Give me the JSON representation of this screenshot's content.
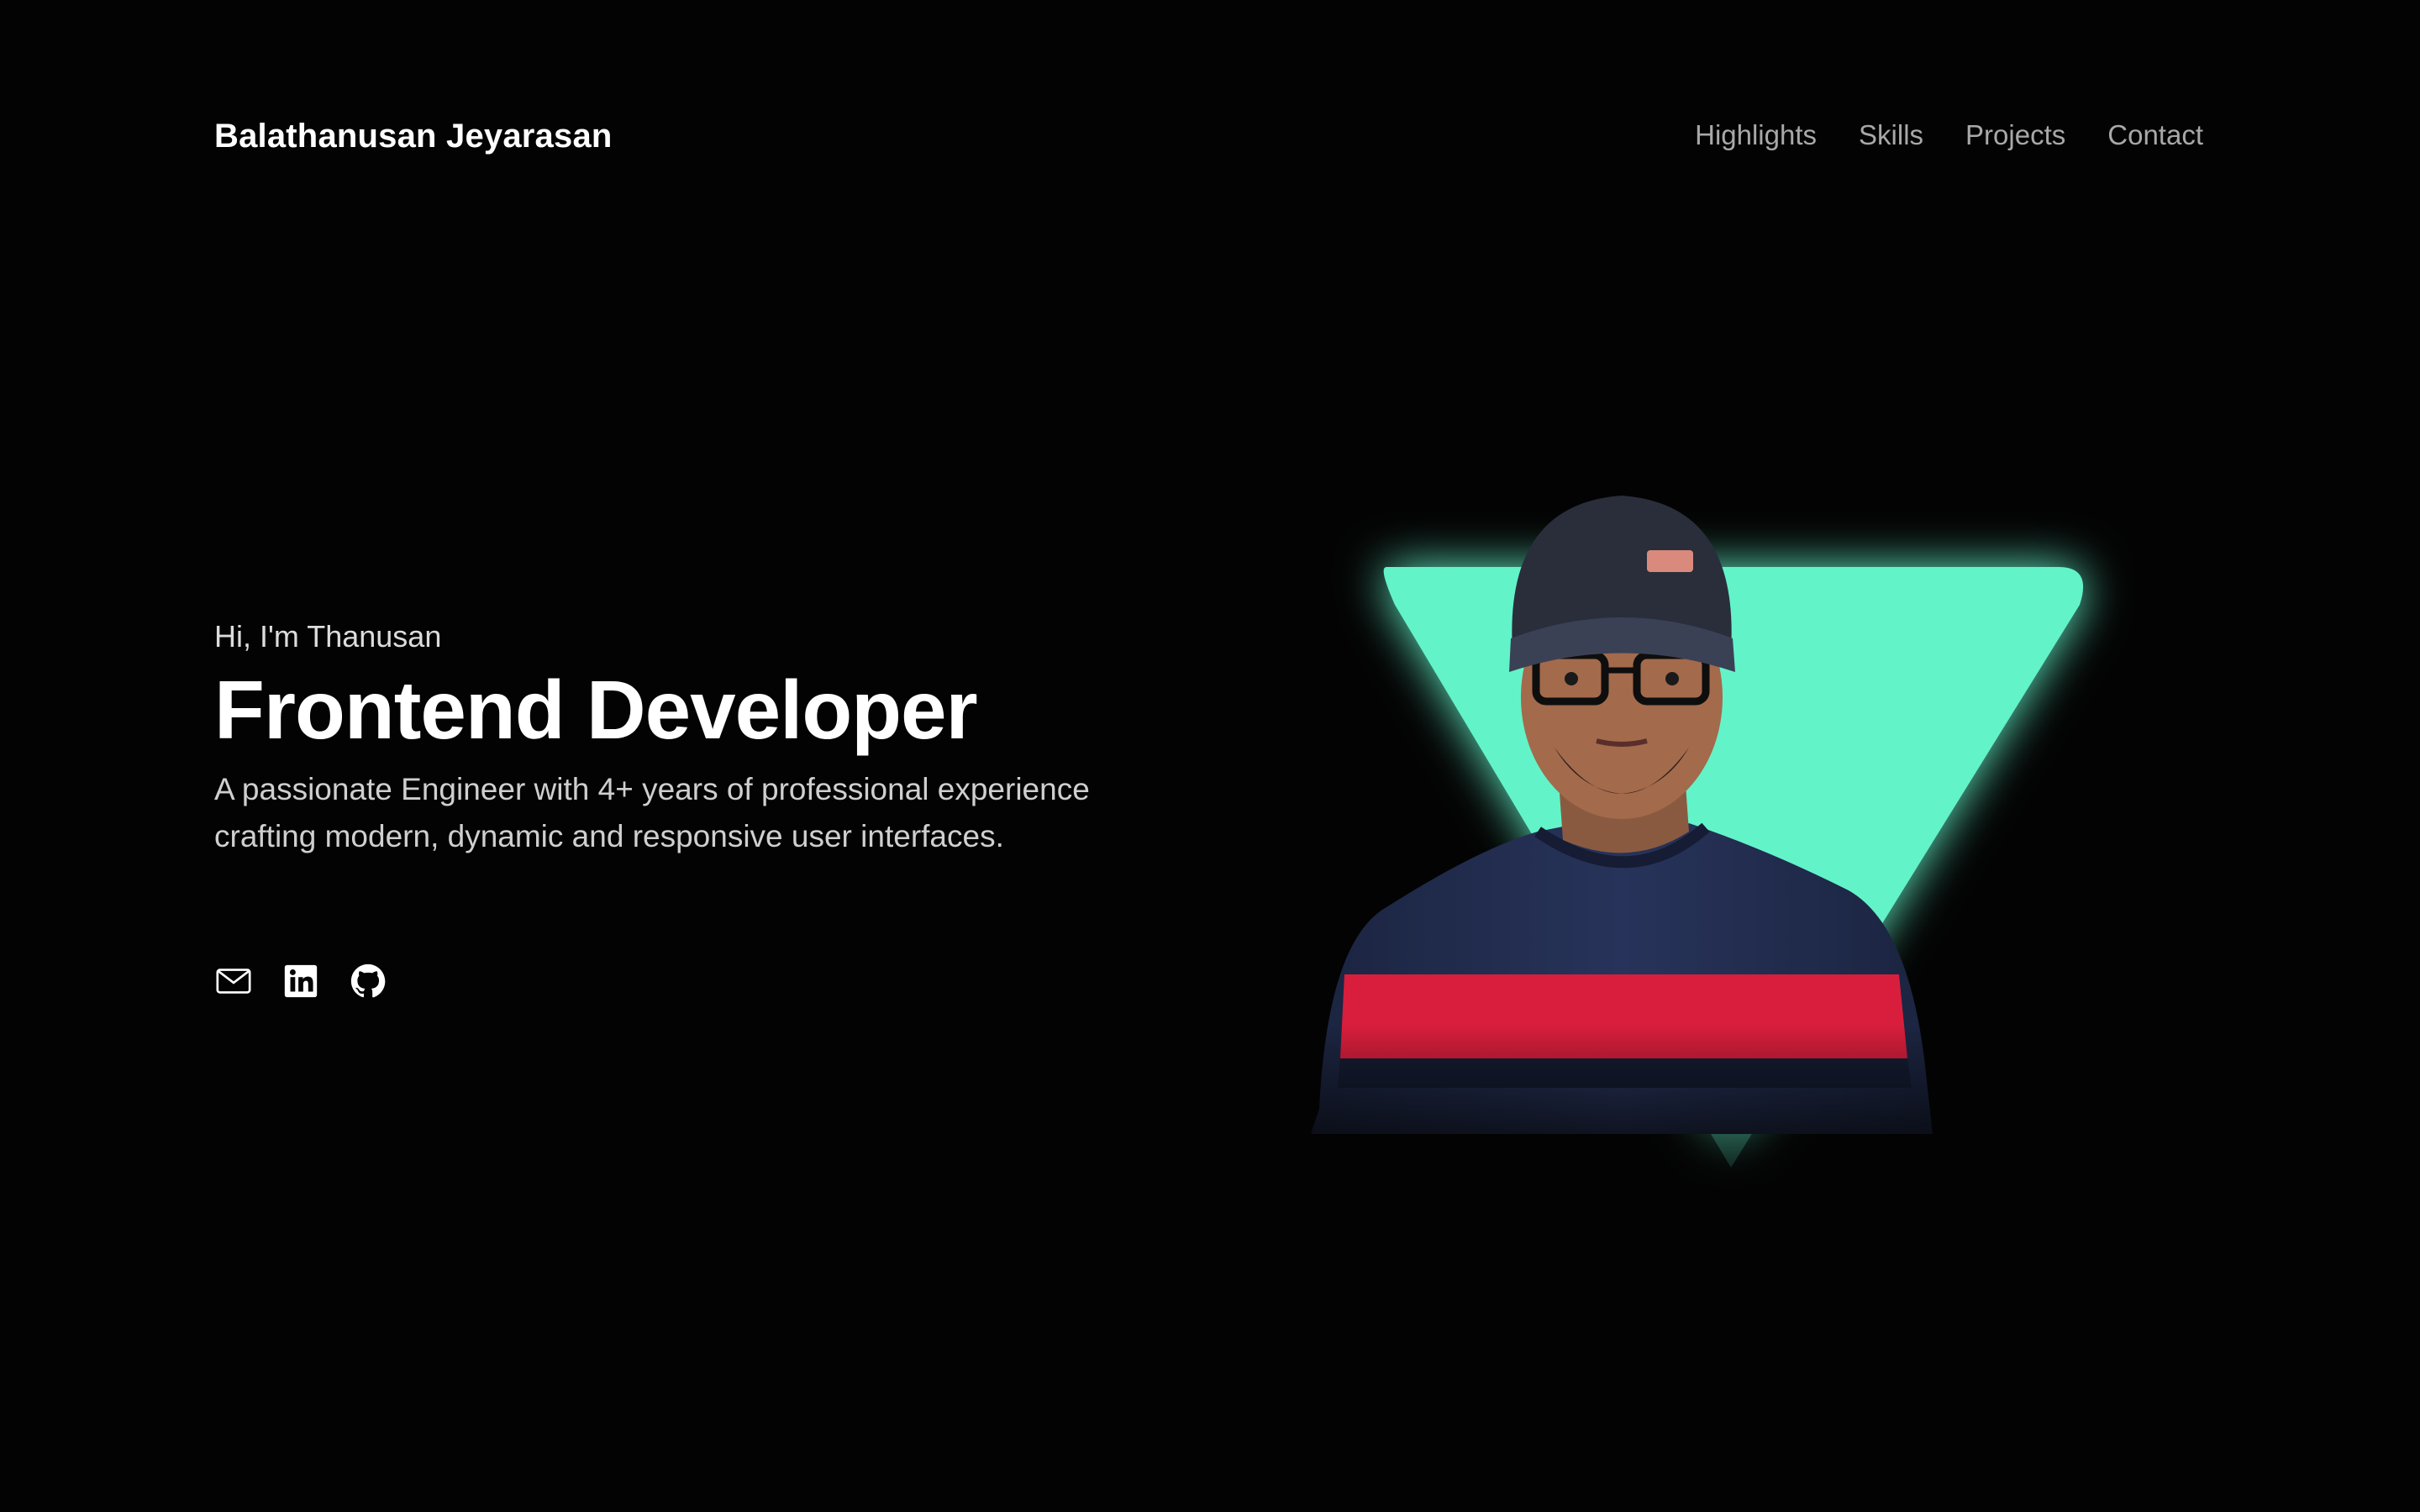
{
  "header": {
    "brand": "Balathanusan Jeyarasan",
    "nav": [
      "Highlights",
      "Skills",
      "Projects",
      "Contact"
    ]
  },
  "hero": {
    "greeting": "Hi, I'm Thanusan",
    "role": "Frontend Developer",
    "tagline": "A passionate Engineer with 4+ years of professional experience crafting modern, dynamic and responsive user interfaces."
  },
  "socials": [
    {
      "icon": "mail-icon"
    },
    {
      "icon": "linkedin-icon"
    },
    {
      "icon": "github-icon"
    }
  ],
  "colors": {
    "background": "#030303",
    "accent": "#64f3c9",
    "text": "#ffffff",
    "nav": "#a8a8a8"
  }
}
